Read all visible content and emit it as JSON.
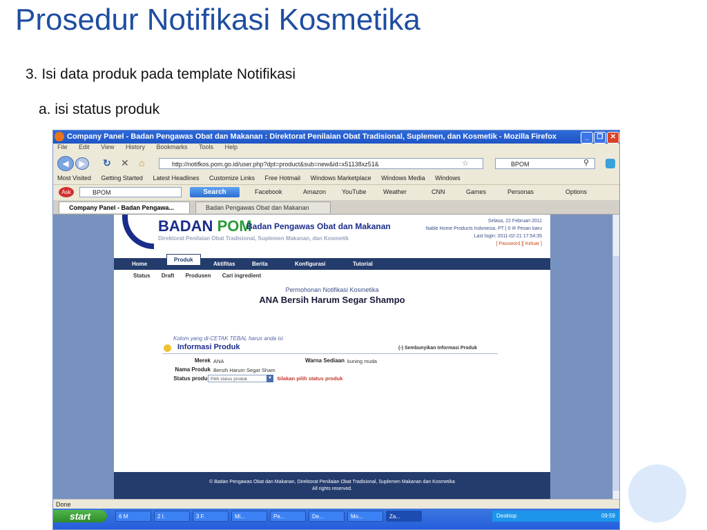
{
  "slide": {
    "title": "Prosedur Notifikasi Kosmetika",
    "step": "3. Isi data produk pada template Notifikasi",
    "substep": "a. isi status produk"
  },
  "browser": {
    "window_title": "Company Panel - Badan Pengawas Obat dan Makanan : Direktorat Penilaian Obat Tradisional, Suplemen, dan Kosmetik - Mozilla Firefox",
    "menu": [
      "File",
      "Edit",
      "View",
      "History",
      "Bookmarks",
      "Tools",
      "Help"
    ],
    "url": "http://notifkos.pom.go.id/user.php?dpt=product&sub=new&id=x51138xz51&",
    "search_engine_value": "BPOM",
    "bookmarks": [
      "Most Visited",
      "Getting Started",
      "Latest Headlines",
      "Customize Links",
      "Free Hotmail",
      "Windows Marketplace",
      "Windows Media",
      "Windows"
    ],
    "toolbar": {
      "ask_value": "BPOM",
      "search_label": "Search",
      "items": [
        "Facebook",
        "Amazon",
        "YouTube",
        "Weather",
        "CNN",
        "Games",
        "Personas"
      ],
      "options_label": "Options"
    },
    "tabs": [
      {
        "label": "Company Panel - Badan Pengawa...",
        "active": true
      },
      {
        "label": "Badan Pengawas Obat dan Makanan",
        "active": false
      }
    ],
    "status_text": "Done"
  },
  "site": {
    "logo_badan": "BADAN",
    "logo_pom": "POM",
    "logo_name": "Badan Pengawas Obat dan Makanan",
    "logo_directorate": "Direktorat Penilaian Obat Tradisional, Suplemen Makanan, dan Kosmetik",
    "header_date": "Selasa, 22 Februari 2011",
    "header_company": "Nable Home Products Indonesia, PT | 0",
    "header_mail": "Pesan baru",
    "header_login": "Last login: 2011-02-21 17:54:35",
    "header_password": "[ Password ]",
    "header_logout": "[ Keluar ]",
    "nav": [
      "Home",
      "Produk",
      "Aktifitas",
      "Berita",
      "Konfigurasi",
      "Tutorial"
    ],
    "active_nav": "Produk",
    "subnav": [
      "Status",
      "Draft",
      "Produsen",
      "Cari ingredient"
    ],
    "request_heading": "Permohonan Notifikasi Kosmetika",
    "product_title": "ANA Bersih Harum Segar Shampo",
    "note": "Kolom yang di-CETAK TEBAL harus anda isi",
    "section_title": "Informasi Produk",
    "hide_link": "(-) Sembunyikan Informasi Produk",
    "fields": {
      "merek_label": "Merek",
      "merek_value": "ANA",
      "warna_label": "Warna Sediaan",
      "warna_value": "kuning muda",
      "nama_label": "Nama Produk",
      "nama_value": "Bersih Harum Segar Sham",
      "status_label": "Status produk",
      "status_placeholder": "Pilih status produk",
      "status_warning": "Silakan pilih status produk"
    },
    "footer_line1": "© Badan Pengawas Obat dan Makanan, Direktorat Penilaian Obat Tradisional, Suplemen Makanan dan Kosmetika",
    "footer_line2": "All rights reserved."
  },
  "taskbar": {
    "start_label": "start",
    "tasks": [
      "6 M",
      "2 I.",
      "3 F.",
      "Mi...",
      "Pe...",
      "De...",
      "Mo...",
      "Za..."
    ],
    "desktop_label": "Desktop",
    "clock": "09:59"
  },
  "colors": {
    "slide_title": "#1f4ea1",
    "nav_bar": "#243c6c",
    "warning": "#c0392b"
  }
}
